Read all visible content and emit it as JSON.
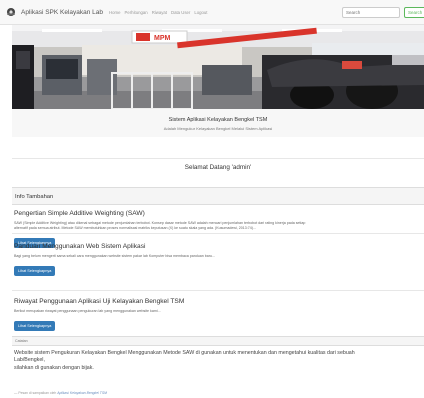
{
  "navbar": {
    "brand": "Aplikasi SPK Kelayakan Lab",
    "links": [
      "Home",
      "Perhitungan",
      "Riwayat",
      "Data User",
      "Logout"
    ],
    "search_placeholder": "Search",
    "search_button": "Search"
  },
  "hero": {
    "sign_text": "MPM"
  },
  "jumbotron": {
    "title": "Sistem Aplikasi Kelayakan Bengkel TSM",
    "subtitle": "Adalah Mengukur Kelayakan Bengkel Melalui Sistem Aplikasi"
  },
  "welcome": "Selamat Datang 'admin'",
  "info_heading": "Info Tambahan",
  "sections": [
    {
      "title": "Pengertian Simple Additive Weighting (SAW)",
      "text1": "SAW (Simple Additive Weighting) atau dikenal sebagai metode penjumlahan terbobot. Konsep dasar metode SAW adalah mencari penjumlahan terbobot dari rating kinerja pada setiap",
      "text2": "alternatif pada semua atribut. Metode SAW membutuhkan proses normalisasi matriks keputusan (X) ke suatu skala yang ada. (Kusumadewi, 2013:74)...",
      "button": "Lihat Selengkapnya"
    },
    {
      "title": "Panduan Menggunakan Web Sistem Aplikasi",
      "text1": "Bagi yang belum mengerti sama sekali cara menggunakan website sistem pakar lab Komputer bisa membaca panduan baru...",
      "button": "Lihat Selengkapnya"
    },
    {
      "title": "Riwayat Penggunaan Aplikasi Uji Kelayakan Bengkel TSM",
      "text1": "Berikut merupakan riwayat penggunaan pengukuran lab yang menggunakan website kami...",
      "button": "Lihat Selengkapnya"
    }
  ],
  "catatan": {
    "heading": "Catatan",
    "line1": "Website sistem Pengukuran Kelayakan Bengkel Menggunakan Metode SAW di gunakan untuk menentukan dan mengetahui kualitas dari sebuah",
    "line2": "Lab/Bengkel,",
    "line3": "silahkan di gunakan dengan bijak.",
    "footer_prefix": "— Pesan di sampaikan oleh",
    "footer_source": "Aplikasi Kelayakan Bengkel TSM"
  },
  "colors": {
    "primary_button": "#337ab7",
    "search_button": "#5cb85c",
    "sign_red": "#d9342b"
  },
  "icons": {
    "brand_logo": "cog-bird-logo"
  }
}
